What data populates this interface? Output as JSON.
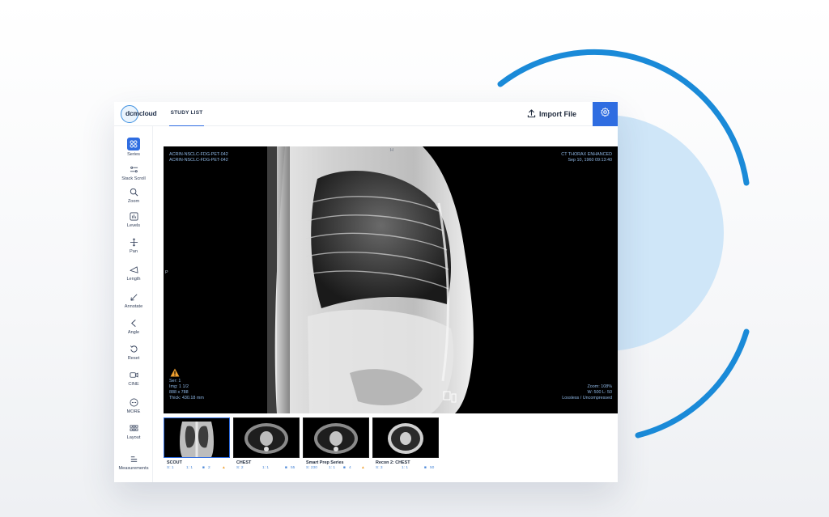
{
  "brand": {
    "logo_text": "dcmcloud"
  },
  "topbar": {
    "tab_study_list": "STUDY LIST",
    "import_label": "Import File",
    "icons": {
      "import": "upload-icon",
      "settings": "gear-icon"
    },
    "accent_color": "#2f6de1"
  },
  "sidebar": {
    "items": [
      {
        "label": "Series",
        "icon": "grid-icon",
        "active": true
      },
      {
        "label": "Stack Scroll",
        "icon": "stack-scroll-icon"
      },
      {
        "label": "Zoom",
        "icon": "magnifier-icon"
      },
      {
        "label": "Levels",
        "icon": "levels-icon"
      },
      {
        "label": "Pan",
        "icon": "pan-icon"
      },
      {
        "label": "Length",
        "icon": "ruler-icon"
      },
      {
        "label": "Annotate",
        "icon": "arrow-annotate-icon"
      },
      {
        "label": "Angle",
        "icon": "angle-icon"
      },
      {
        "label": "Reset",
        "icon": "reset-icon"
      },
      {
        "label": "CINE",
        "icon": "video-icon"
      },
      {
        "label": "MORE",
        "icon": "more-icon"
      },
      {
        "label": "Layout",
        "icon": "layout-icon"
      },
      {
        "label": "Measurements",
        "icon": "list-icon"
      }
    ]
  },
  "viewer": {
    "top_left": [
      "ACRIN-NSCLC-FDG-PET-042",
      "ACRIN-NSCLC-FDG-PET-042"
    ],
    "top_right": [
      "CT THORAX ENHANCED",
      "Sep 10, 1960 09:13:40"
    ],
    "bottom_left": [
      "Ser: 1",
      "Img: 1 1/2",
      "888 x 788",
      "Thick: 430.18 mm"
    ],
    "bottom_right": [
      "Zoom: 108%",
      "W: 500 L: 50",
      "Lossless / Uncompressed"
    ],
    "orientation_left": "P",
    "orientation_top": "H",
    "warning_icon": "warning-triangle-icon",
    "overlay_color": "#8fb8e6"
  },
  "thumbnails": [
    {
      "name": "SCOUT",
      "series": "S: 1",
      "instances": "1: 1",
      "count": "2",
      "warning": true,
      "selected": true
    },
    {
      "name": "CHEST",
      "series": "S: 2",
      "instances": "1: 1",
      "count": "55",
      "warning": false,
      "selected": false
    },
    {
      "name": "Smart Prep Series",
      "series": "S: 230",
      "instances": "1: 1",
      "count": "4",
      "warning": true,
      "selected": false
    },
    {
      "name": "Recon 2: CHEST",
      "series": "S: 3",
      "instances": "1: 1",
      "count": "50",
      "warning": false,
      "selected": false
    }
  ]
}
